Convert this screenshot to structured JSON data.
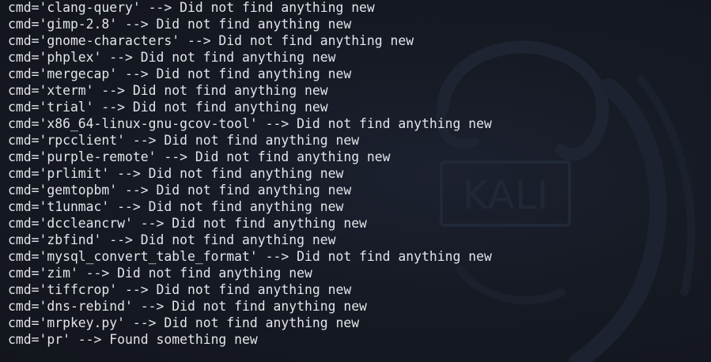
{
  "terminal": {
    "watermark_text": "KALI",
    "lines": [
      "cmd='clang-query' --> Did not find anything new",
      "cmd='gimp-2.8' --> Did not find anything new",
      "cmd='gnome-characters' --> Did not find anything new",
      "cmd='phplex' --> Did not find anything new",
      "cmd='mergecap' --> Did not find anything new",
      "cmd='xterm' --> Did not find anything new",
      "cmd='trial' --> Did not find anything new",
      "cmd='x86_64-linux-gnu-gcov-tool' --> Did not find anything new",
      "cmd='rpcclient' --> Did not find anything new",
      "cmd='purple-remote' --> Did not find anything new",
      "cmd='prlimit' --> Did not find anything new",
      "cmd='gemtopbm' --> Did not find anything new",
      "cmd='t1unmac' --> Did not find anything new",
      "cmd='dccleancrw' --> Did not find anything new",
      "cmd='zbfind' --> Did not find anything new",
      "cmd='mysql_convert_table_format' --> Did not find anything new",
      "cmd='zim' --> Did not find anything new",
      "cmd='tiffcrop' --> Did not find anything new",
      "cmd='dns-rebind' --> Did not find anything new",
      "cmd='mrpkey.py' --> Did not find anything new",
      "cmd='pr' --> Found something new"
    ]
  },
  "colors": {
    "background": "#161a24",
    "text": "#e3e5ea",
    "watermark": "#1f2533"
  }
}
